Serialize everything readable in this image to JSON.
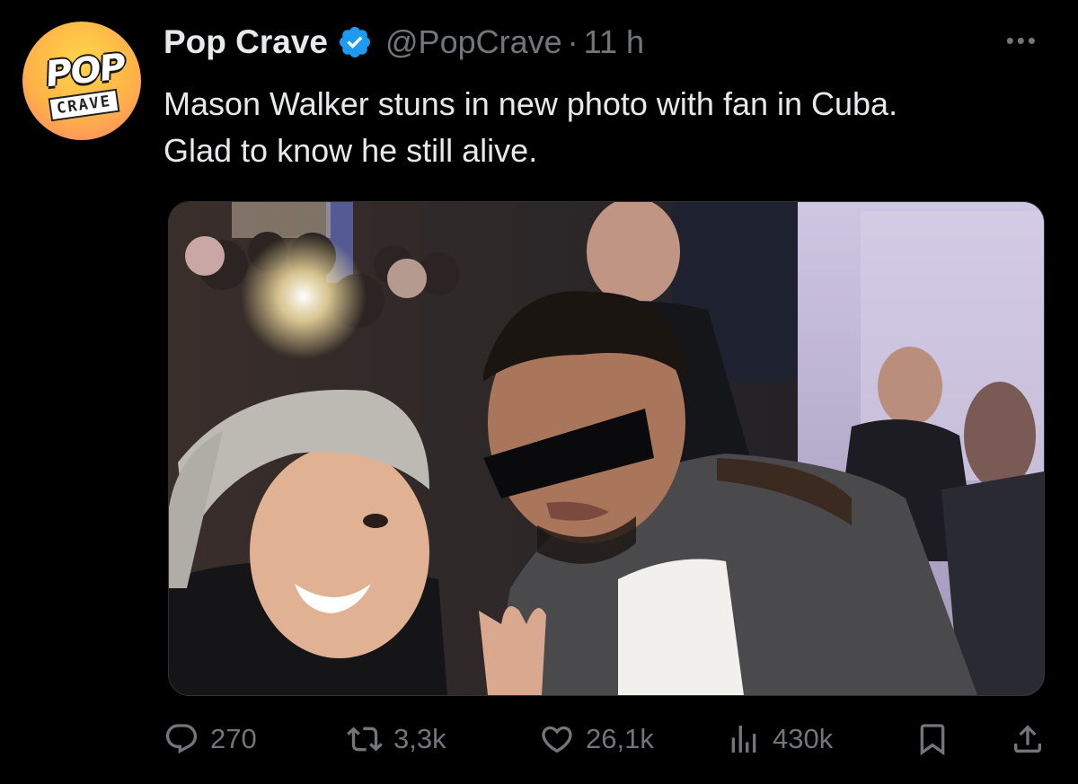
{
  "account": {
    "display_name": "Pop Crave",
    "handle": "@PopCrave",
    "separator": "·",
    "time": "11 h",
    "avatar_logo_top": "POP",
    "avatar_logo_bottom": "CRAVE",
    "verified": true
  },
  "more_label": "•••",
  "tweet": {
    "text": "Mason Walker stuns in new photo with fan in Cuba. Glad to know he still alive."
  },
  "actions": {
    "replies": "270",
    "reposts": "3,3k",
    "likes": "26,1k",
    "views": "430k"
  },
  "icons": {
    "reply": "reply-icon",
    "repost": "repost-icon",
    "like": "heart-icon",
    "views": "views-icon",
    "bookmark": "bookmark-icon",
    "share": "share-icon",
    "verified": "verified-badge-icon"
  },
  "colors": {
    "background": "#000000",
    "text_primary": "#e7e9ea",
    "text_secondary": "#71767b",
    "verified_blue": "#1d9bf0"
  }
}
